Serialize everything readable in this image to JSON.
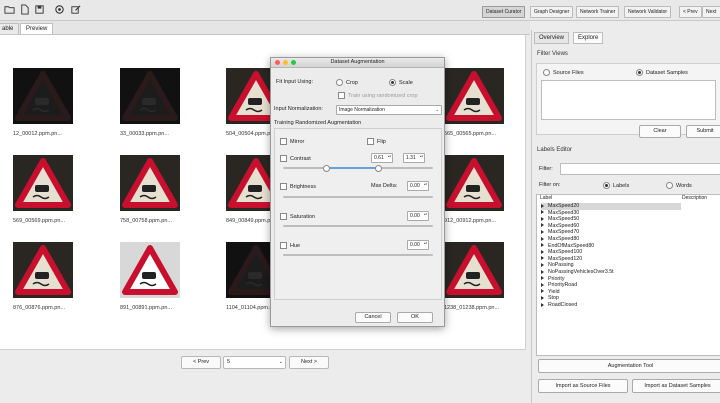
{
  "toolbar": {
    "tabs": [
      "Dataset Curator",
      "Graph Designer",
      "Network Trainer",
      "Network Validator",
      "< Prev",
      "Next"
    ],
    "active_tab": 0
  },
  "left": {
    "tabs": [
      "able",
      "Preview"
    ],
    "thumbs": [
      {
        "caption": "12_00012.ppm.pn...",
        "dark": true
      },
      {
        "caption": "33_00033.ppm.pn...",
        "dark": true
      },
      {
        "caption": "504_00504.ppm.pn...",
        "dark": false
      },
      {
        "caption": "",
        "dark": false
      },
      {
        "caption": "565_00565.ppm.pn...",
        "dark": false
      },
      {
        "caption": "569_00569.ppm.pn...",
        "dark": false
      },
      {
        "caption": "758_00758.ppm.pn...",
        "dark": false
      },
      {
        "caption": "849_00849.ppm.pn...",
        "dark": false
      },
      {
        "caption": "",
        "dark": false
      },
      {
        "caption": "912_00912.ppm.pn...",
        "dark": false
      },
      {
        "caption": "876_00876.ppm.pn...",
        "dark": false
      },
      {
        "caption": "891_00891.ppm.pn...",
        "dark": false,
        "bright": true
      },
      {
        "caption": "1104_01104.ppm.pn...",
        "dark": true
      },
      {
        "caption": "",
        "dark": false
      },
      {
        "caption": "1238_01238.ppm.pn...",
        "dark": false
      }
    ],
    "pager": {
      "prev": "< Prev",
      "page": "5",
      "next": "Next >"
    }
  },
  "right": {
    "tabs": [
      "Overview",
      "Explore"
    ],
    "filter_views": {
      "title": "Filter Views",
      "source_files": "Source Files",
      "dataset_samples": "Dataset Samples",
      "clear": "Clear",
      "submit": "Submit"
    },
    "labels_editor": {
      "title": "Labels Editor",
      "filter_label": "Filter:",
      "filter_on": "Filter on:",
      "labels": "Labels",
      "words": "Words",
      "col_label": "Label",
      "col_desc": "Description",
      "items": [
        "MaxSpeed20",
        "MaxSpeed30",
        "MaxSpeed50",
        "MaxSpeed60",
        "MaxSpeed70",
        "MaxSpeed80",
        "EndOfMaxSpeed80",
        "MaxSpeed100",
        "MaxSpeed120",
        "NoPassing",
        "NoPassingVehiclesOver3.5t",
        "Priority",
        "PriorityRoad",
        "Yield",
        "Stop",
        "RoadClosed"
      ],
      "selected_index": 0
    },
    "augmentation_tool": "Augmentation Tool",
    "import_source": "Import as Source Files",
    "import_dataset": "Import as Dataset Samples"
  },
  "dialog": {
    "title": "Dataset Augmentation",
    "fit_label": "Fit Input Using:",
    "crop": "Crop",
    "scale": "Scale",
    "train_randomized_crop": "Train using randomized crop",
    "input_norm_label": "Input Normalization:",
    "input_norm_value": "Image Normalization",
    "section": "Training Randomized Augmentation",
    "mirror": "Mirror",
    "flip": "Flip",
    "contrast": "Contrast",
    "contrast_min": "0.61",
    "contrast_max": "1.31",
    "brightness": "Brightness",
    "max_delta": "Max Delta:",
    "brightness_value": "0.00",
    "saturation": "Saturation",
    "saturation_value": "0.00",
    "hue": "Hue",
    "hue_value": "0.00",
    "cancel": "Cancel",
    "ok": "OK"
  },
  "colors": {
    "sign_red": "#c8102e",
    "traffic_red": "#ff5f57",
    "traffic_yellow": "#febc2e",
    "traffic_green": "#28c840"
  }
}
